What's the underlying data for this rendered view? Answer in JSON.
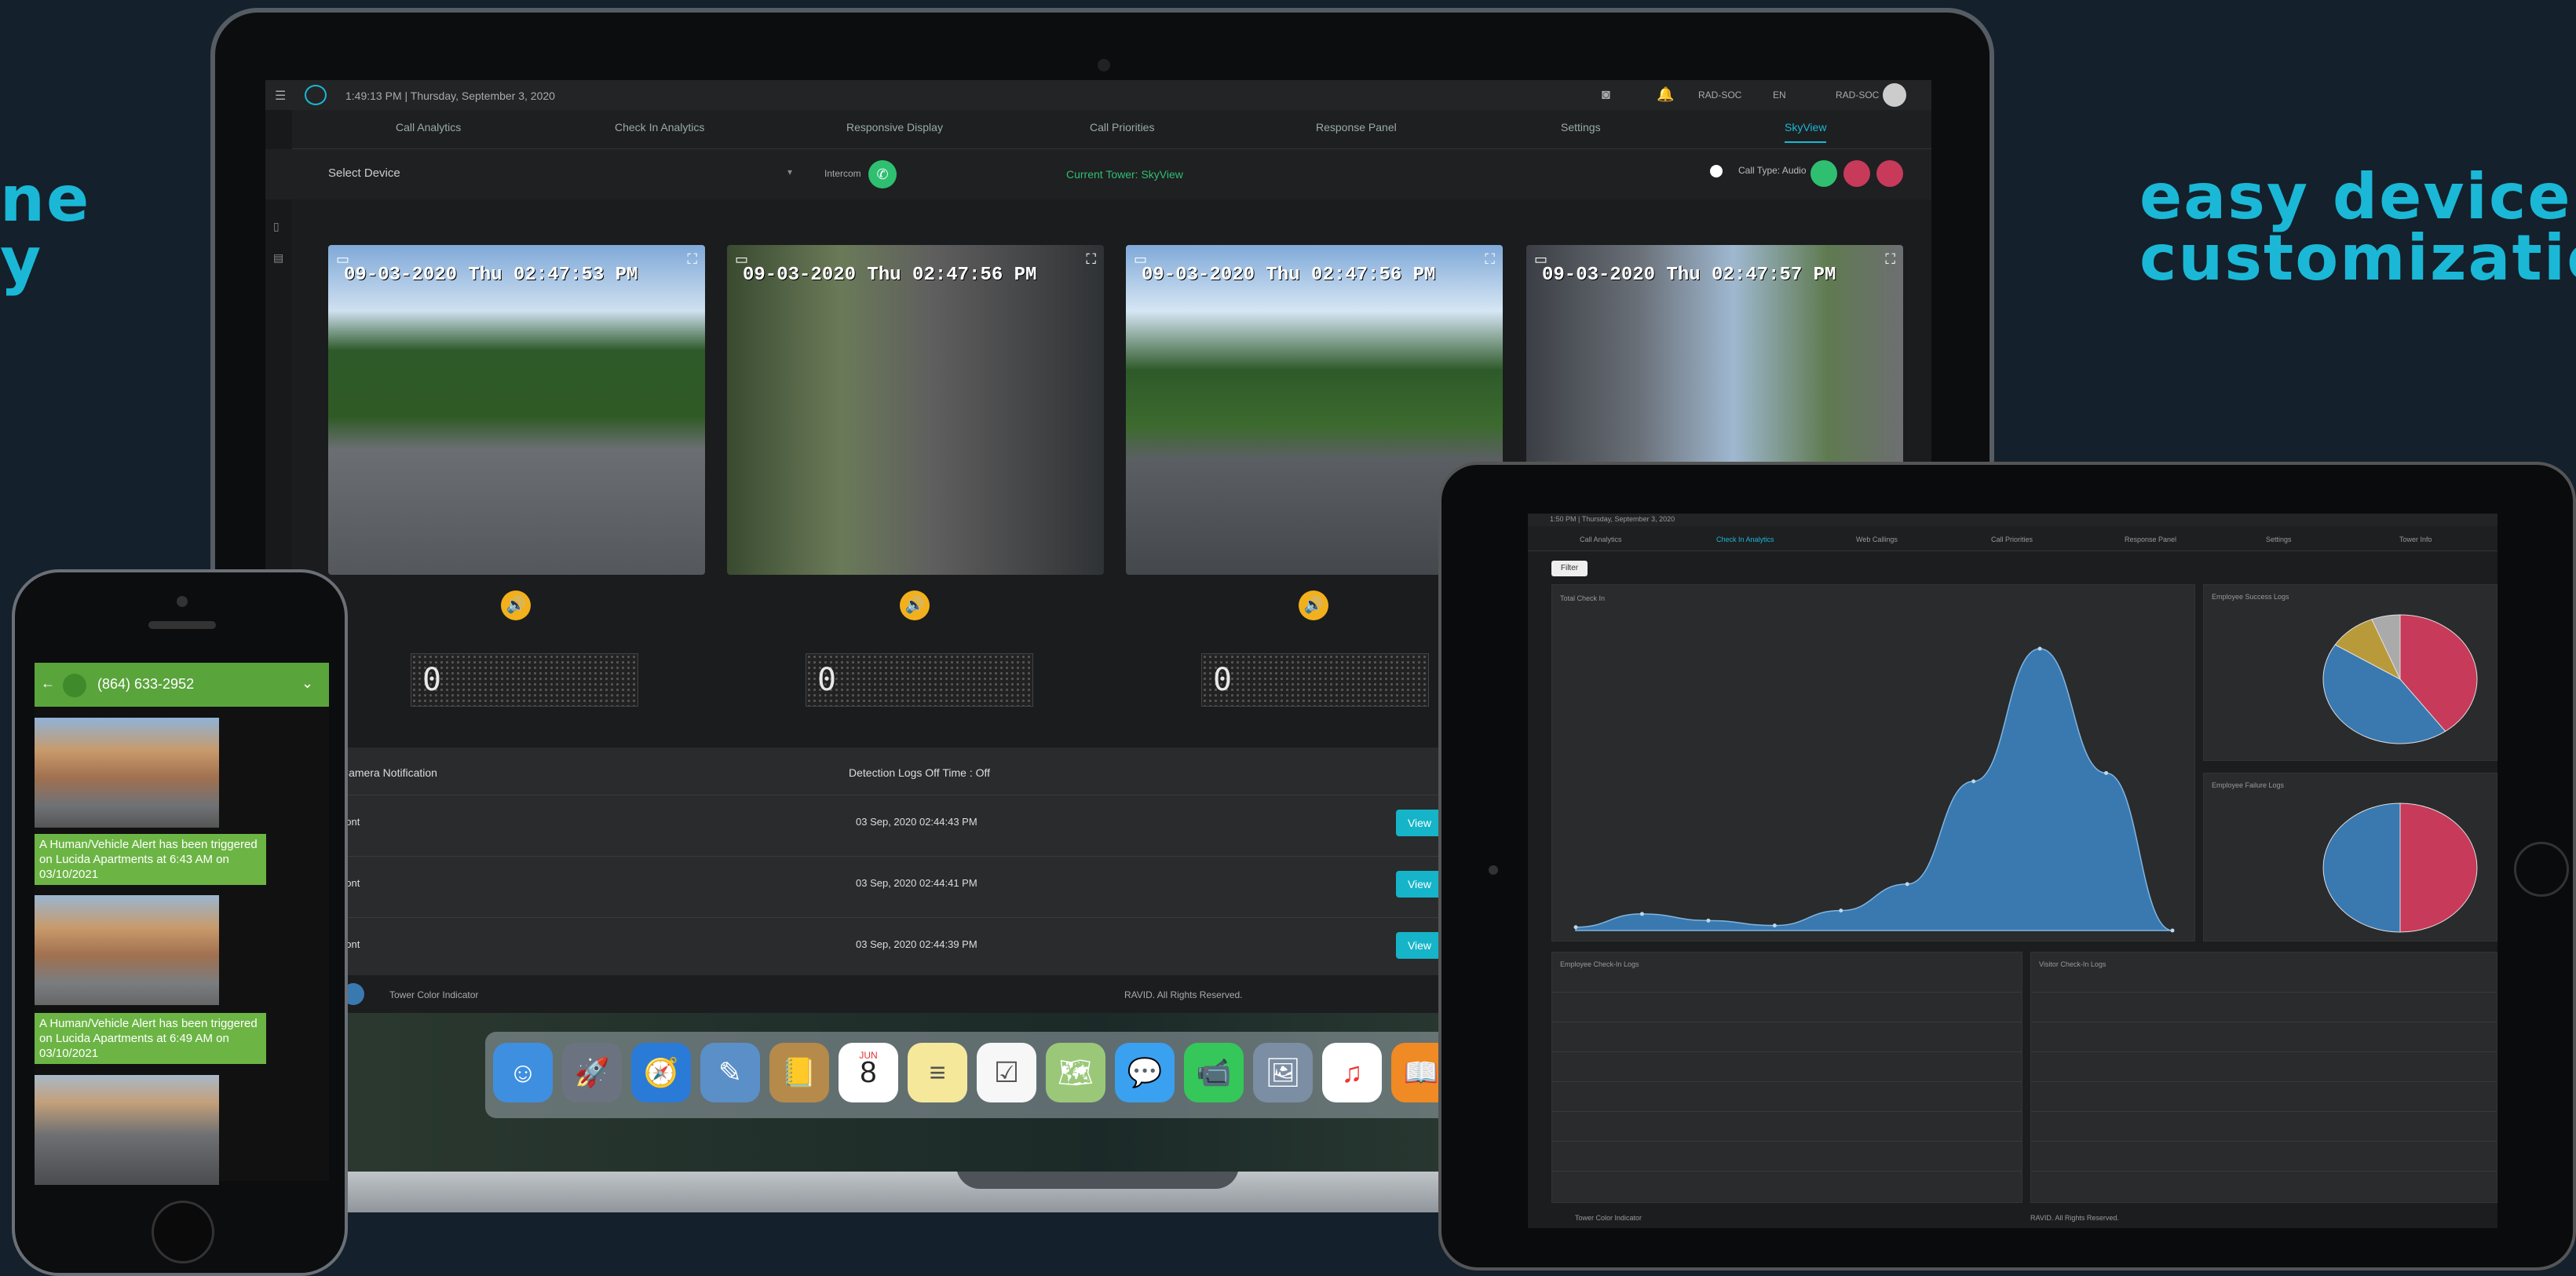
{
  "hero": {
    "left_line1": "ne",
    "left_line2": "y",
    "right_line1": "easy device",
    "right_line2": "customization"
  },
  "laptop": {
    "datetime": "1:49:13 PM | Thursday, September 3, 2020",
    "user_role": "RAD-SOC",
    "language": "EN",
    "user_name": "RAD-SOC",
    "tabs": [
      "Call Analytics",
      "Check In Analytics",
      "Responsive Display",
      "Call Priorities",
      "Response Panel",
      "Settings",
      "SkyView"
    ],
    "active_tab": "SkyView",
    "select_device": "Select Device",
    "intercom_label": "Intercom",
    "current_tower": "Current Tower: SkyView",
    "call_type": "Call Type: Audio",
    "cameras": [
      {
        "stamp": "09-03-2020 Thu 02:47:53 PM"
      },
      {
        "stamp": "09-03-2020 Thu 02:47:56 PM"
      },
      {
        "stamp": "09-03-2020 Thu 02:47:56 PM"
      },
      {
        "stamp": "09-03-2020 Thu 02:47:57 PM"
      }
    ],
    "matrix_digits": [
      "0",
      "0",
      "0"
    ],
    "notif_title": "Camera Notification",
    "detection_title": "Detection Logs Off Time : Off",
    "logs": [
      {
        "type": "Front",
        "time": "03 Sep, 2020 02:44:43 PM",
        "action": "View"
      },
      {
        "type": "Front",
        "time": "03 Sep, 2020 02:44:41 PM",
        "action": "View"
      },
      {
        "type": "Front",
        "time": "03 Sep, 2020 02:44:39 PM",
        "action": "View"
      }
    ],
    "footer_left": "Tower Color Indicator",
    "footer_right": "RAVID. All Rights Reserved.",
    "dock_icons": [
      "finder-icon",
      "launchpad-icon",
      "safari-icon",
      "preview-icon",
      "contacts-icon",
      "calendar-icon",
      "notes-icon",
      "reminders-icon",
      "maps-icon",
      "messages-icon",
      "facetime-icon",
      "photos-icon",
      "itunes-icon",
      "ibooks-icon"
    ],
    "calendar_month": "JUN",
    "calendar_day": "8"
  },
  "phone": {
    "phone_number": "(864) 633-2952",
    "alerts": [
      "A Human/Vehicle Alert has been triggered on Lucida Apartments at 6:43 AM on 03/10/2021",
      "A Human/Vehicle Alert has been triggered on Lucida Apartments at 6:49 AM on 03/10/2021"
    ]
  },
  "tablet": {
    "datetime": "1:50 PM | Thursday, September 3, 2020",
    "tabs": [
      "Call Analytics",
      "Check In Analytics",
      "Web Callings",
      "Call Priorities",
      "Response Panel",
      "Settings",
      "Tower Info"
    ],
    "filter_label": "Filter",
    "chart_title": "Total Check In",
    "pie1_title": "Employee Success Logs",
    "pie2_title": "Employee Failure Logs",
    "table1_title": "Employee Check-In Logs",
    "table2_title": "Visitor Check-In Logs",
    "footer_left": "Tower Color Indicator",
    "footer_right": "RAVID. All Rights Reserved."
  },
  "colors": {
    "accent": "#1ab8d6",
    "green": "#2fbf71",
    "red": "#c73a5a",
    "blue": "#3a78b0",
    "amber": "#f2b01c"
  },
  "chart_data": [
    {
      "type": "area",
      "title": "Total Check In",
      "x": [
        1,
        2,
        3,
        4,
        5,
        6,
        7,
        8,
        9,
        10
      ],
      "values": [
        2,
        10,
        6,
        3,
        12,
        28,
        90,
        170,
        95,
        0
      ],
      "ylim": [
        0,
        180
      ]
    },
    {
      "type": "pie",
      "title": "Employee Success Logs",
      "values": [
        40,
        44,
        10,
        6
      ],
      "colors": [
        "#c73a5a",
        "#3a78b0",
        "#b89a3a",
        "#aaaaaa"
      ]
    },
    {
      "type": "pie",
      "title": "Employee Failure Logs",
      "values": [
        50,
        50
      ],
      "colors": [
        "#c73a5a",
        "#3a78b0"
      ]
    }
  ]
}
